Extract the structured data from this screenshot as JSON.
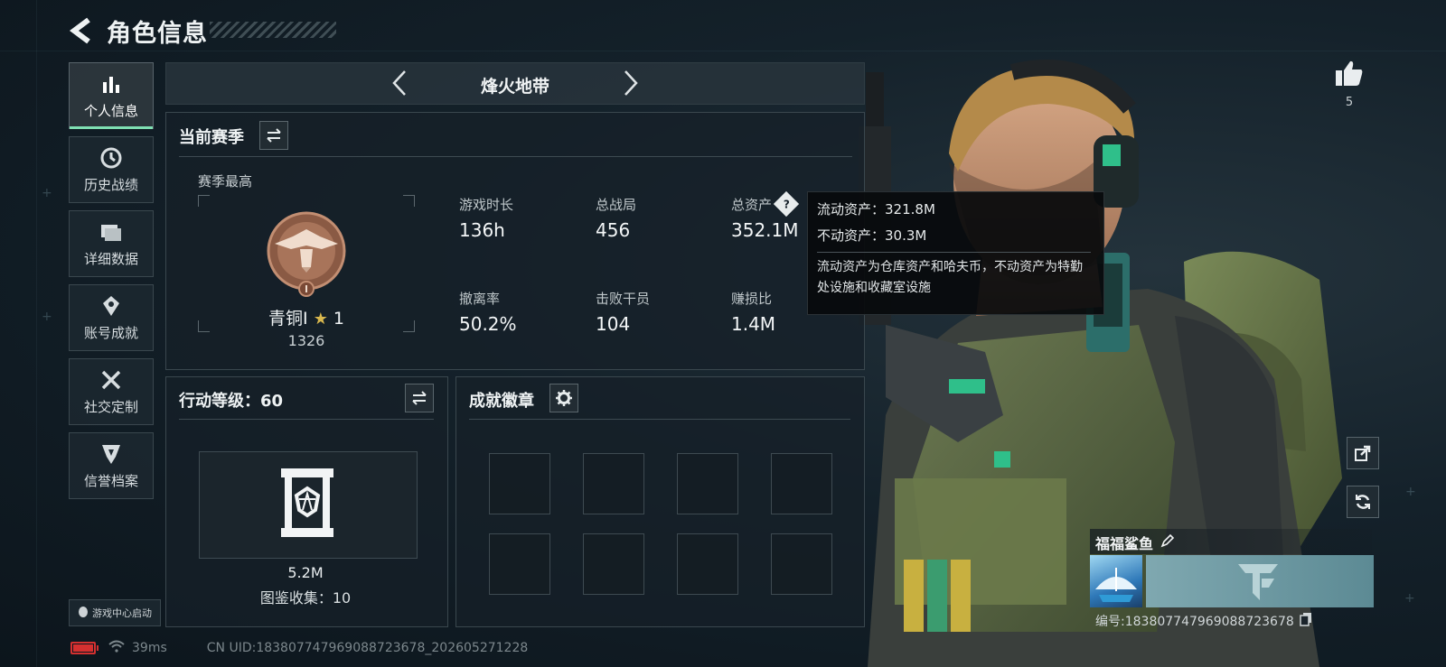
{
  "header": {
    "title": "角色信息"
  },
  "sidebar": {
    "items": [
      {
        "label": "个人信息",
        "icon": "bar-chart-icon",
        "active": true
      },
      {
        "label": "历史战绩",
        "icon": "clock-icon",
        "active": false
      },
      {
        "label": "详细数据",
        "icon": "folder-icon",
        "active": false
      },
      {
        "label": "账号成就",
        "icon": "achievement-icon",
        "active": false
      },
      {
        "label": "社交定制",
        "icon": "tools-icon",
        "active": false
      },
      {
        "label": "信誉档案",
        "icon": "shield-icon",
        "active": false
      }
    ],
    "launch_label": "游戏中心启动"
  },
  "mode": {
    "title": "烽火地带"
  },
  "season": {
    "title": "当前赛季",
    "best_label": "赛季最高",
    "rank": {
      "name": "青铜I",
      "stars": "1",
      "score": "1326"
    },
    "stats": [
      {
        "label": "游戏时长",
        "value": "136h"
      },
      {
        "label": "总战局",
        "value": "456"
      },
      {
        "label": "总资产",
        "value": "352.1M"
      },
      {
        "label": "撤离率",
        "value": "50.2%"
      },
      {
        "label": "击败干员",
        "value": "104"
      },
      {
        "label": "赚损比",
        "value": "1.4M"
      }
    ]
  },
  "tooltip": {
    "liquid": "流动资产：321.8M",
    "fixed": "不动资产：30.3M",
    "desc": "流动资产为仓库资产和哈夫币，不动资产为特勤处设施和收藏室设施"
  },
  "level": {
    "title": "行动等级：60",
    "value": "5.2M",
    "collection": "图鉴收集：10"
  },
  "badges": {
    "title": "成就徽章"
  },
  "player": {
    "likes": "5",
    "nickname": "福福鲨鱼",
    "id": "编号:183807747969088723678"
  },
  "status": {
    "battery_level": 0.9,
    "ping": "39ms",
    "uid": "CN UID:183807747969088723678_202605271228"
  },
  "colors": {
    "accent": "#7fe0b3",
    "battery": "#d53030",
    "panel": "#16202a"
  }
}
